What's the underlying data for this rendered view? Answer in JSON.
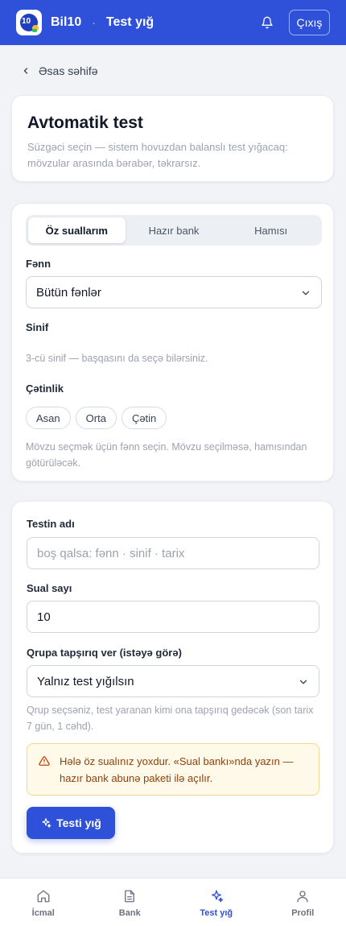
{
  "header": {
    "brand": "Bil10",
    "separator": "·",
    "page_title": "Test yığ",
    "logout_label": "Çıxış",
    "logo_text": "10",
    "icons": [
      "bell-icon"
    ]
  },
  "breadcrumb": {
    "back_label": "Əsas səhifə"
  },
  "intro": {
    "title": "Avtomatik test",
    "subtitle": "Süzgəci seçin — sistem hovuzdan balanslı test yığacaq: mövzular arasında bərabər, təkrarsız."
  },
  "filters": {
    "tabs": [
      {
        "label": "Öz suallarım",
        "active": true
      },
      {
        "label": "Hazır bank",
        "active": false
      },
      {
        "label": "Hamısı",
        "active": false
      }
    ],
    "subject_label": "Fənn",
    "subject_value": "Bütün fənlər",
    "grade_label": "Sinif",
    "grade_hint": "3-cü sinif — başqasını da seçə bilərsiniz.",
    "difficulty_label": "Çətinlik",
    "difficulty_options": [
      "Asan",
      "Orta",
      "Çətin"
    ],
    "topic_hint": "Mövzu seçmək üçün fənn seçin. Mövzu seçilməsə, hamısından götürüləcək."
  },
  "test_form": {
    "name_label": "Testin adı",
    "name_placeholder": "boş qalsa: fənn · sinif · tarix",
    "count_label": "Sual sayı",
    "count_value": "10",
    "group_label": "Qrupa tapşırıq ver (istəyə görə)",
    "group_value": "Yalnız test yığılsın",
    "group_hint": "Qrup seçsəniz, test yaranan kimi ona tapşırıq gedəcək (son tarix 7 gün, 1 cəhd).",
    "alert_text": "Hələ öz sualınız yoxdur. «Sual bankı»nda yazın — hazır bank abunə paketi ilə açılır.",
    "submit_label": "Testi yığ"
  },
  "bottom_nav": [
    {
      "label": "İcmal",
      "icon": "home-icon",
      "active": false
    },
    {
      "label": "Bank",
      "icon": "document-icon",
      "active": false
    },
    {
      "label": "Test yığ",
      "icon": "sparkles-icon",
      "active": true
    },
    {
      "label": "Profil",
      "icon": "user-icon",
      "active": false
    }
  ],
  "colors": {
    "primary": "#2f50d9",
    "alert_bg": "#fef9e8",
    "alert_text": "#92400e"
  }
}
